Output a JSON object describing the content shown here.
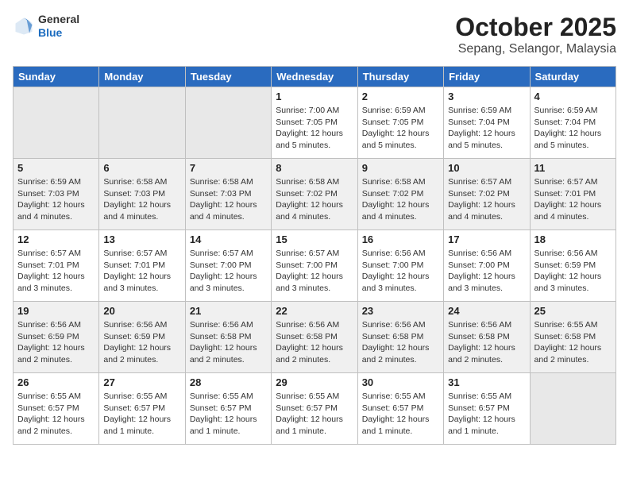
{
  "header": {
    "logo_general": "General",
    "logo_blue": "Blue",
    "month": "October 2025",
    "location": "Sepang, Selangor, Malaysia"
  },
  "days_of_week": [
    "Sunday",
    "Monday",
    "Tuesday",
    "Wednesday",
    "Thursday",
    "Friday",
    "Saturday"
  ],
  "weeks": [
    [
      {
        "day": "",
        "info": ""
      },
      {
        "day": "",
        "info": ""
      },
      {
        "day": "",
        "info": ""
      },
      {
        "day": "1",
        "info": "Sunrise: 7:00 AM\nSunset: 7:05 PM\nDaylight: 12 hours\nand 5 minutes."
      },
      {
        "day": "2",
        "info": "Sunrise: 6:59 AM\nSunset: 7:05 PM\nDaylight: 12 hours\nand 5 minutes."
      },
      {
        "day": "3",
        "info": "Sunrise: 6:59 AM\nSunset: 7:04 PM\nDaylight: 12 hours\nand 5 minutes."
      },
      {
        "day": "4",
        "info": "Sunrise: 6:59 AM\nSunset: 7:04 PM\nDaylight: 12 hours\nand 5 minutes."
      }
    ],
    [
      {
        "day": "5",
        "info": "Sunrise: 6:59 AM\nSunset: 7:03 PM\nDaylight: 12 hours\nand 4 minutes."
      },
      {
        "day": "6",
        "info": "Sunrise: 6:58 AM\nSunset: 7:03 PM\nDaylight: 12 hours\nand 4 minutes."
      },
      {
        "day": "7",
        "info": "Sunrise: 6:58 AM\nSunset: 7:03 PM\nDaylight: 12 hours\nand 4 minutes."
      },
      {
        "day": "8",
        "info": "Sunrise: 6:58 AM\nSunset: 7:02 PM\nDaylight: 12 hours\nand 4 minutes."
      },
      {
        "day": "9",
        "info": "Sunrise: 6:58 AM\nSunset: 7:02 PM\nDaylight: 12 hours\nand 4 minutes."
      },
      {
        "day": "10",
        "info": "Sunrise: 6:57 AM\nSunset: 7:02 PM\nDaylight: 12 hours\nand 4 minutes."
      },
      {
        "day": "11",
        "info": "Sunrise: 6:57 AM\nSunset: 7:01 PM\nDaylight: 12 hours\nand 4 minutes."
      }
    ],
    [
      {
        "day": "12",
        "info": "Sunrise: 6:57 AM\nSunset: 7:01 PM\nDaylight: 12 hours\nand 3 minutes."
      },
      {
        "day": "13",
        "info": "Sunrise: 6:57 AM\nSunset: 7:01 PM\nDaylight: 12 hours\nand 3 minutes."
      },
      {
        "day": "14",
        "info": "Sunrise: 6:57 AM\nSunset: 7:00 PM\nDaylight: 12 hours\nand 3 minutes."
      },
      {
        "day": "15",
        "info": "Sunrise: 6:57 AM\nSunset: 7:00 PM\nDaylight: 12 hours\nand 3 minutes."
      },
      {
        "day": "16",
        "info": "Sunrise: 6:56 AM\nSunset: 7:00 PM\nDaylight: 12 hours\nand 3 minutes."
      },
      {
        "day": "17",
        "info": "Sunrise: 6:56 AM\nSunset: 7:00 PM\nDaylight: 12 hours\nand 3 minutes."
      },
      {
        "day": "18",
        "info": "Sunrise: 6:56 AM\nSunset: 6:59 PM\nDaylight: 12 hours\nand 3 minutes."
      }
    ],
    [
      {
        "day": "19",
        "info": "Sunrise: 6:56 AM\nSunset: 6:59 PM\nDaylight: 12 hours\nand 2 minutes."
      },
      {
        "day": "20",
        "info": "Sunrise: 6:56 AM\nSunset: 6:59 PM\nDaylight: 12 hours\nand 2 minutes."
      },
      {
        "day": "21",
        "info": "Sunrise: 6:56 AM\nSunset: 6:58 PM\nDaylight: 12 hours\nand 2 minutes."
      },
      {
        "day": "22",
        "info": "Sunrise: 6:56 AM\nSunset: 6:58 PM\nDaylight: 12 hours\nand 2 minutes."
      },
      {
        "day": "23",
        "info": "Sunrise: 6:56 AM\nSunset: 6:58 PM\nDaylight: 12 hours\nand 2 minutes."
      },
      {
        "day": "24",
        "info": "Sunrise: 6:56 AM\nSunset: 6:58 PM\nDaylight: 12 hours\nand 2 minutes."
      },
      {
        "day": "25",
        "info": "Sunrise: 6:55 AM\nSunset: 6:58 PM\nDaylight: 12 hours\nand 2 minutes."
      }
    ],
    [
      {
        "day": "26",
        "info": "Sunrise: 6:55 AM\nSunset: 6:57 PM\nDaylight: 12 hours\nand 2 minutes."
      },
      {
        "day": "27",
        "info": "Sunrise: 6:55 AM\nSunset: 6:57 PM\nDaylight: 12 hours\nand 1 minute."
      },
      {
        "day": "28",
        "info": "Sunrise: 6:55 AM\nSunset: 6:57 PM\nDaylight: 12 hours\nand 1 minute."
      },
      {
        "day": "29",
        "info": "Sunrise: 6:55 AM\nSunset: 6:57 PM\nDaylight: 12 hours\nand 1 minute."
      },
      {
        "day": "30",
        "info": "Sunrise: 6:55 AM\nSunset: 6:57 PM\nDaylight: 12 hours\nand 1 minute."
      },
      {
        "day": "31",
        "info": "Sunrise: 6:55 AM\nSunset: 6:57 PM\nDaylight: 12 hours\nand 1 minute."
      },
      {
        "day": "",
        "info": ""
      }
    ]
  ]
}
